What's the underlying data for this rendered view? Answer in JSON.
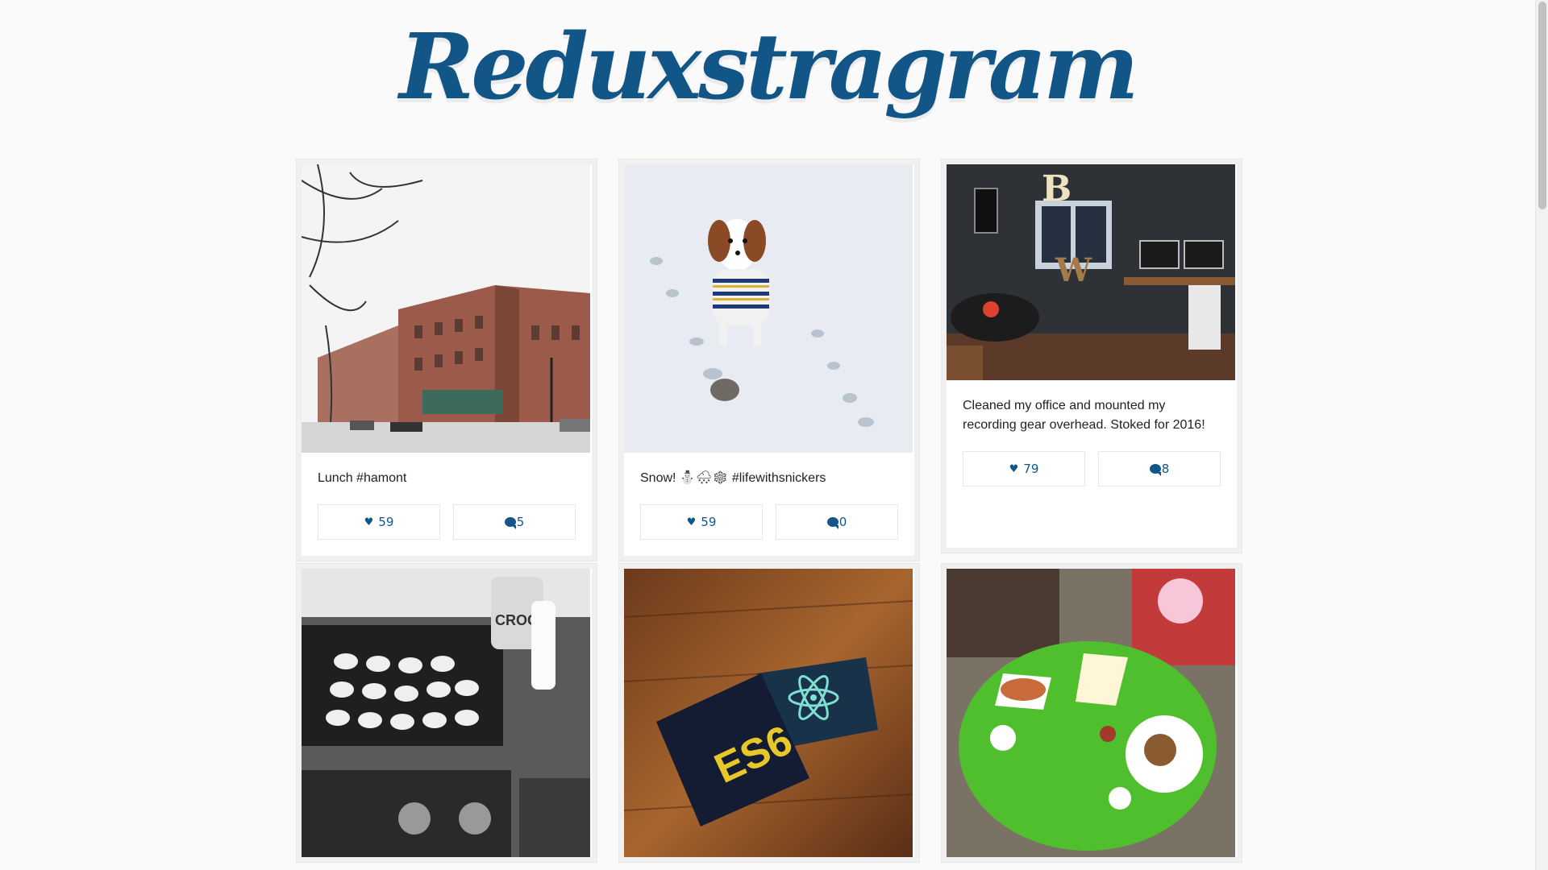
{
  "app": {
    "logo": "Reduxstragram"
  },
  "posts": [
    {
      "caption": "Lunch #hamont",
      "likes": "59",
      "comments": "5",
      "photo": "snowy-brick-street"
    },
    {
      "caption": "Snow! ⛄🌨❄ #lifewithsnickers",
      "likes": "59",
      "comments": "0",
      "photo": "dog-in-snow"
    },
    {
      "caption": "Cleaned my office and mounted my recording gear overhead. Stoked for 2016!",
      "likes": "79",
      "comments": "8",
      "photo": "home-office"
    },
    {
      "caption": "",
      "likes": "",
      "comments": "",
      "photo": "pancakes-on-griddle"
    },
    {
      "caption": "",
      "likes": "",
      "comments": "",
      "photo": "es6-react-stickers"
    },
    {
      "caption": "",
      "likes": "",
      "comments": "",
      "photo": "picnic-table-lunch"
    }
  ],
  "ui": {
    "like_icon": "heart-icon",
    "comment_icon": "speech-bubble-icon",
    "accent": "#125688"
  }
}
